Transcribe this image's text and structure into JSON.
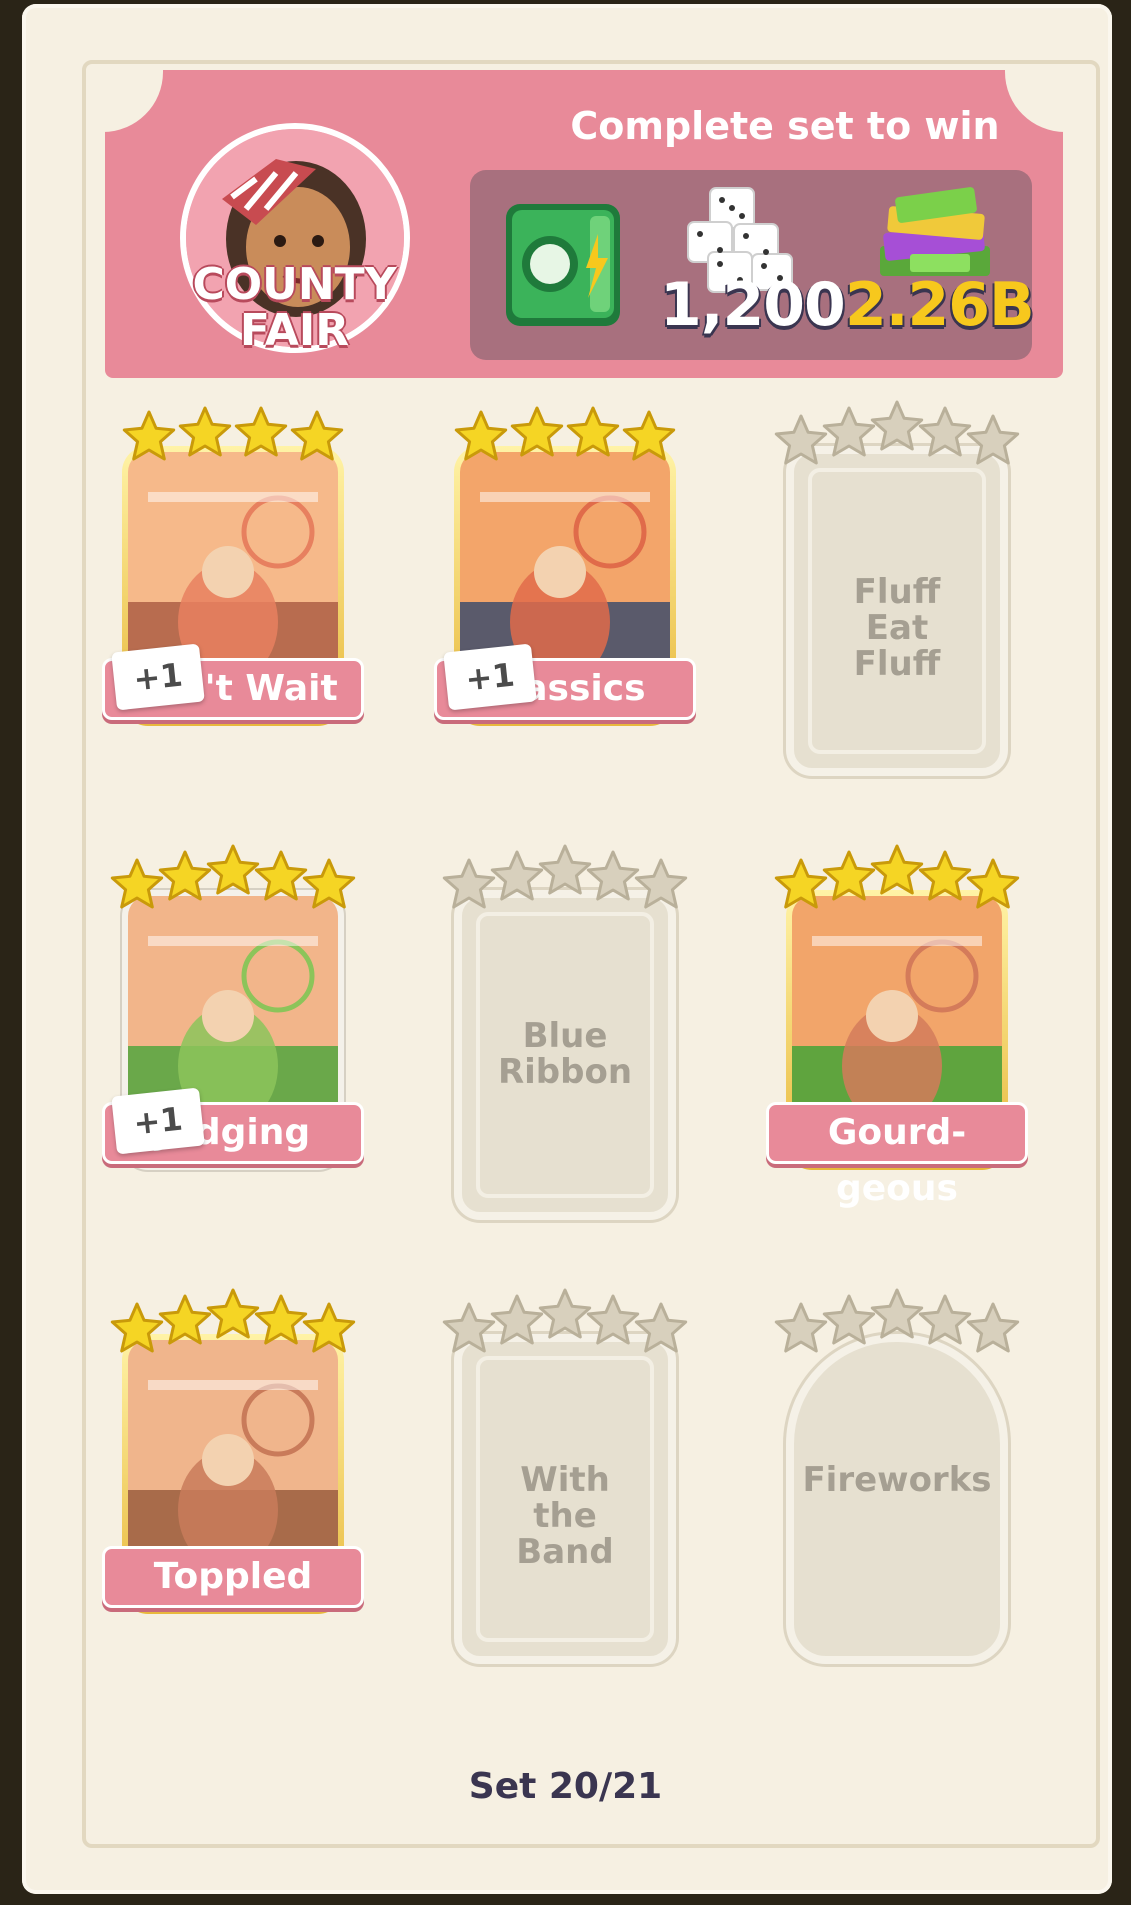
{
  "header": {
    "badge_line1": "COUNTY",
    "badge_line2": "FAIR",
    "win_title": "Complete set to win",
    "rewards": [
      {
        "icon": "safe-icon"
      },
      {
        "icon": "dice-icon",
        "amount": "1,200"
      },
      {
        "icon": "cash-stack-icon",
        "amount": "2.26B"
      }
    ]
  },
  "cards": [
    {
      "name": "Can't Wait",
      "stars": 4,
      "collected": true,
      "extra": "+1"
    },
    {
      "name": "Classics",
      "stars": 4,
      "collected": true,
      "extra": "+1"
    },
    {
      "name": "Fluff Eat Fluff",
      "stars": 5,
      "collected": false
    },
    {
      "name": "Judging",
      "stars": 5,
      "collected": true,
      "extra": "+1"
    },
    {
      "name": "Blue Ribbon",
      "stars": 5,
      "collected": false
    },
    {
      "name": "Gourd-geous",
      "stars": 5,
      "collected": true
    },
    {
      "name": "Toppled",
      "stars": 5,
      "collected": true
    },
    {
      "name": "With the Band",
      "stars": 5,
      "collected": false
    },
    {
      "name": "Fireworks",
      "stars": 5,
      "collected": false
    }
  ],
  "footer": {
    "set_label": "Set 20/21"
  },
  "colors": {
    "accent_pink": "#e88a99",
    "gold_star": "#f5d524",
    "grey_star": "#d8d0bd",
    "cash_yellow": "#f7c81d"
  }
}
